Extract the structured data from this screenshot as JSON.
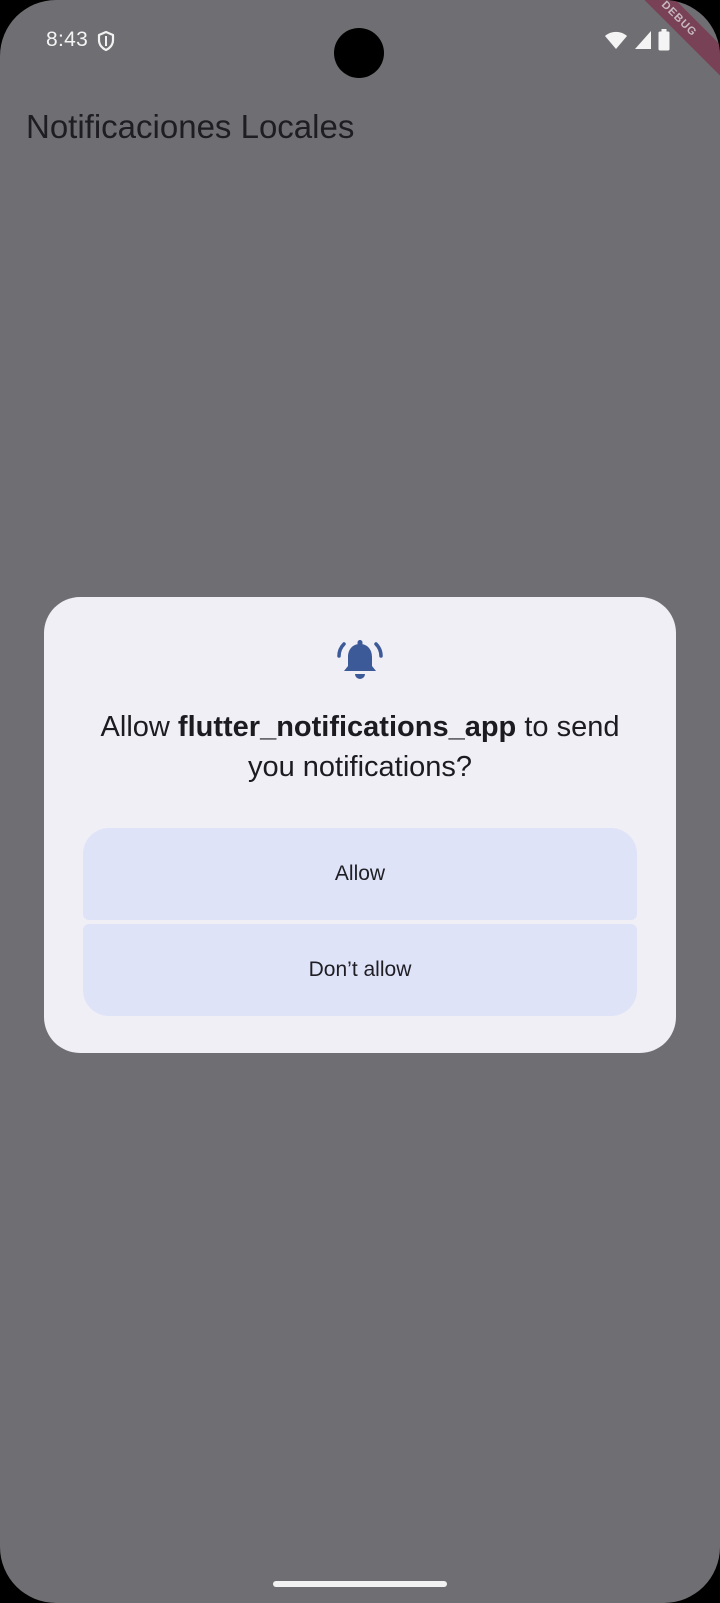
{
  "status_bar": {
    "time": "8:43",
    "left_icons": [
      "shield-icon"
    ],
    "right_icons": [
      "wifi-icon",
      "signal-icon",
      "battery-icon"
    ]
  },
  "debug_banner": "DEBUG",
  "app_bar": {
    "title": "Notificaciones Locales"
  },
  "permission_dialog": {
    "icon": "notification-bell-icon",
    "message_prefix": "Allow ",
    "app_name": "flutter_notifications_app",
    "message_suffix": " to send you notifications?",
    "allow_label": "Allow",
    "deny_label": "Don’t allow"
  },
  "colors": {
    "scrim_background": "#6f6e72",
    "dialog_background": "#f0eff5",
    "button_background": "#dfe3f8",
    "icon_accent": "#3d5a98"
  }
}
